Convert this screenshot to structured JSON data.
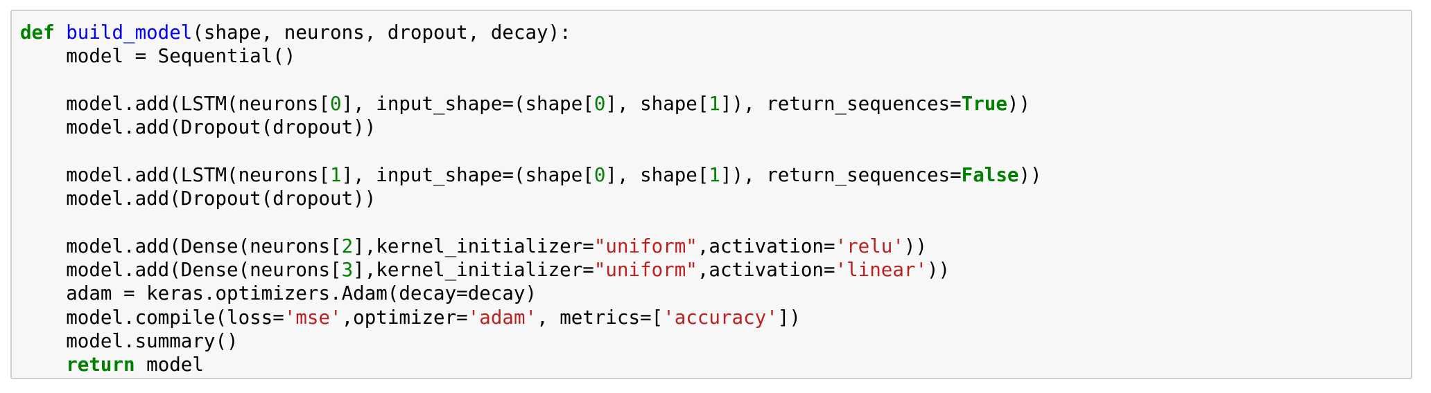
{
  "code_cell": {
    "lines": [
      [
        {
          "t": "kw",
          "v": "def"
        },
        {
          "t": "plain",
          "v": " "
        },
        {
          "t": "fn",
          "v": "build_model"
        },
        {
          "t": "plain",
          "v": "(shape, neurons, dropout, decay):"
        }
      ],
      [
        {
          "t": "plain",
          "v": "    model = Sequential()"
        }
      ],
      [],
      [
        {
          "t": "plain",
          "v": "    model.add(LSTM(neurons["
        },
        {
          "t": "num",
          "v": "0"
        },
        {
          "t": "plain",
          "v": "], input_shape=(shape["
        },
        {
          "t": "num",
          "v": "0"
        },
        {
          "t": "plain",
          "v": "], shape["
        },
        {
          "t": "num",
          "v": "1"
        },
        {
          "t": "plain",
          "v": "]), return_sequences="
        },
        {
          "t": "kw",
          "v": "True"
        },
        {
          "t": "plain",
          "v": "))"
        }
      ],
      [
        {
          "t": "plain",
          "v": "    model.add(Dropout(dropout))"
        }
      ],
      [],
      [
        {
          "t": "plain",
          "v": "    model.add(LSTM(neurons["
        },
        {
          "t": "num",
          "v": "1"
        },
        {
          "t": "plain",
          "v": "], input_shape=(shape["
        },
        {
          "t": "num",
          "v": "0"
        },
        {
          "t": "plain",
          "v": "], shape["
        },
        {
          "t": "num",
          "v": "1"
        },
        {
          "t": "plain",
          "v": "]), return_sequences="
        },
        {
          "t": "kw",
          "v": "False"
        },
        {
          "t": "plain",
          "v": "))"
        }
      ],
      [
        {
          "t": "plain",
          "v": "    model.add(Dropout(dropout))"
        }
      ],
      [],
      [
        {
          "t": "plain",
          "v": "    model.add(Dense(neurons["
        },
        {
          "t": "num",
          "v": "2"
        },
        {
          "t": "plain",
          "v": "],kernel_initializer="
        },
        {
          "t": "str",
          "v": "\"uniform\""
        },
        {
          "t": "plain",
          "v": ",activation="
        },
        {
          "t": "str",
          "v": "'relu'"
        },
        {
          "t": "plain",
          "v": "))"
        }
      ],
      [
        {
          "t": "plain",
          "v": "    model.add(Dense(neurons["
        },
        {
          "t": "num",
          "v": "3"
        },
        {
          "t": "plain",
          "v": "],kernel_initializer="
        },
        {
          "t": "str",
          "v": "\"uniform\""
        },
        {
          "t": "plain",
          "v": ",activation="
        },
        {
          "t": "str",
          "v": "'linear'"
        },
        {
          "t": "plain",
          "v": "))"
        }
      ],
      [
        {
          "t": "plain",
          "v": "    adam = keras.optimizers.Adam(decay=decay)"
        }
      ],
      [
        {
          "t": "plain",
          "v": "    model.compile(loss="
        },
        {
          "t": "str",
          "v": "'mse'"
        },
        {
          "t": "plain",
          "v": ",optimizer="
        },
        {
          "t": "str",
          "v": "'adam'"
        },
        {
          "t": "plain",
          "v": ", metrics=["
        },
        {
          "t": "str",
          "v": "'accuracy'"
        },
        {
          "t": "plain",
          "v": "])"
        }
      ],
      [
        {
          "t": "plain",
          "v": "    model.summary()"
        }
      ],
      [
        {
          "t": "plain",
          "v": "    "
        },
        {
          "t": "kw",
          "v": "return"
        },
        {
          "t": "plain",
          "v": " model"
        }
      ]
    ]
  },
  "colors": {
    "cell_background": "#f7f7f7",
    "cell_border": "#cfcfcf",
    "keyword": "#008000",
    "function_name": "#0000ff",
    "number": "#008000",
    "string": "#ba2121",
    "plain": "#000000"
  }
}
